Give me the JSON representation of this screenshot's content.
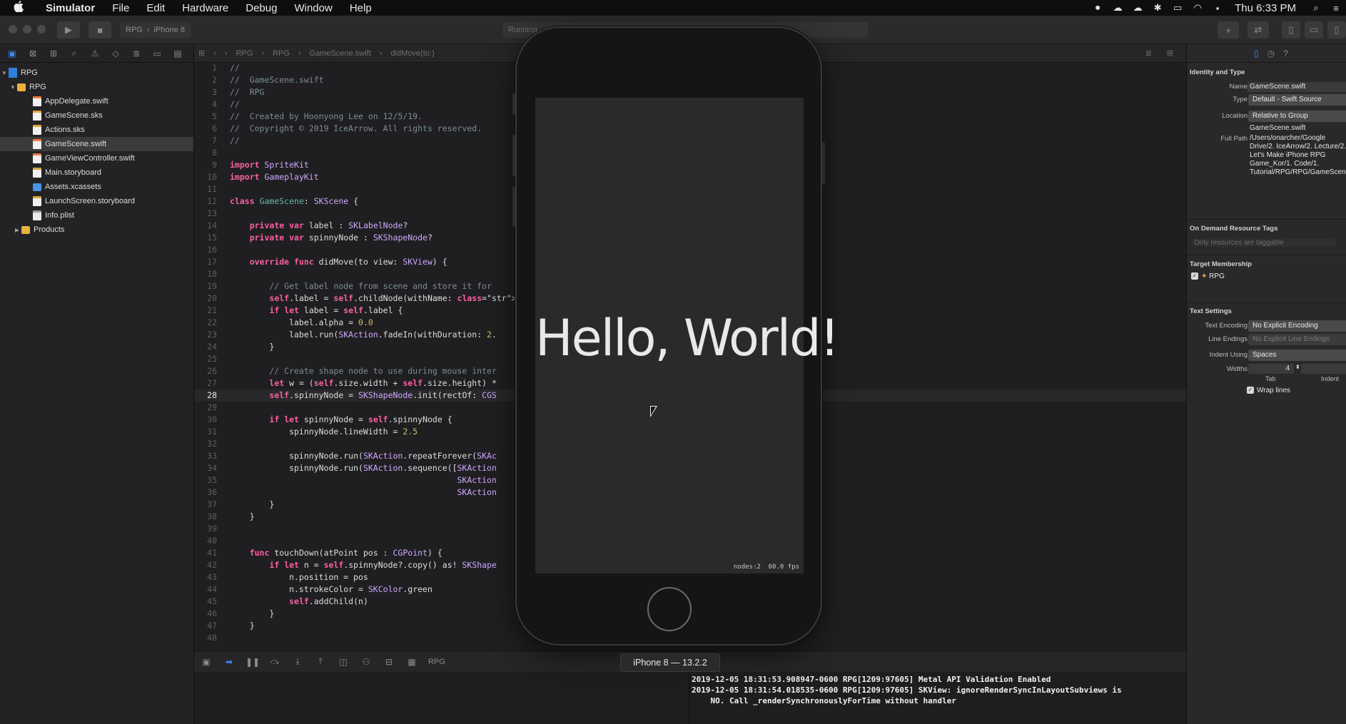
{
  "menubar": {
    "apple": "",
    "app_name": "Simulator",
    "items": [
      "File",
      "Edit",
      "Hardware",
      "Debug",
      "Window",
      "Help"
    ],
    "clock": "Thu 6:33 PM"
  },
  "toolbar": {
    "scheme": "RPG",
    "device": "iPhone 8",
    "activity": "Running"
  },
  "navigator": {
    "project": "RPG",
    "group": "RPG",
    "files": [
      {
        "name": "AppDelegate.swift",
        "kind": "swift"
      },
      {
        "name": "GameScene.sks",
        "kind": "sks"
      },
      {
        "name": "Actions.sks",
        "kind": "sks"
      },
      {
        "name": "GameScene.swift",
        "kind": "swift"
      },
      {
        "name": "GameViewController.swift",
        "kind": "swift"
      },
      {
        "name": "Main.storyboard",
        "kind": "sb"
      },
      {
        "name": "Assets.xcassets",
        "kind": "assets"
      },
      {
        "name": "LaunchScreen.storyboard",
        "kind": "sb"
      },
      {
        "name": "Info.plist",
        "kind": "plist"
      }
    ],
    "products": "Products",
    "selected": "GameScene.swift"
  },
  "jumpbar": {
    "crumbs": [
      "RPG",
      "RPG",
      "GameScene.swift",
      "didMove(to:)"
    ]
  },
  "editor": {
    "current_line": 28,
    "lines": [
      "//",
      "//  GameScene.swift",
      "//  RPG",
      "//",
      "//  Created by Hoonyong Lee on 12/5/19.",
      "//  Copyright © 2019 IceArrow. All rights reserved.",
      "//",
      "",
      "import SpriteKit",
      "import GameplayKit",
      "",
      "class GameScene: SKScene {",
      "",
      "    private var label : SKLabelNode?",
      "    private var spinnyNode : SKShapeNode?",
      "",
      "    override func didMove(to view: SKView) {",
      "",
      "        // Get label node from scene and store it for",
      "        self.label = self.childNode(withName: \"//hello",
      "        if let label = self.label {",
      "            label.alpha = 0.0",
      "            label.run(SKAction.fadeIn(withDuration: 2.",
      "        }",
      "",
      "        // Create shape node to use during mouse inter",
      "        let w = (self.size.width + self.size.height) *",
      "        self.spinnyNode = SKShapeNode.init(rectOf: CGS",
      "",
      "        if let spinnyNode = self.spinnyNode {",
      "            spinnyNode.lineWidth = 2.5",
      "",
      "            spinnyNode.run(SKAction.repeatForever(SKAc",
      "            spinnyNode.run(SKAction.sequence([SKAction",
      "                                              SKAction",
      "                                              SKAction",
      "        }",
      "    }",
      "",
      "",
      "    func touchDown(atPoint pos : CGPoint) {",
      "        if let n = self.spinnyNode?.copy() as! SKShape",
      "            n.position = pos",
      "            n.strokeColor = SKColor.green",
      "            self.addChild(n)",
      "        }",
      "    }",
      ""
    ]
  },
  "debug": {
    "target": "RPG",
    "console_lines": [
      "2019-12-05 18:31:53.908947-0600 RPG[1209:97605] Metal API Validation Enabled",
      "2019-12-05 18:31:54.018535-0600 RPG[1209:97605] SKView: ignoreRenderSyncInLayoutSubviews is",
      "    NO. Call _renderSynchronouslyForTime without handler"
    ]
  },
  "inspector": {
    "identity_title": "Identity and Type",
    "name_label": "Name",
    "name_value": "GameScene.swift",
    "type_label": "Type",
    "type_value": "Default - Swift Source",
    "location_label": "Location",
    "location_value": "Relative to Group",
    "location_file": "GameScene.swift",
    "fullpath_label": "Full Path",
    "fullpath_value": "/Users/onarcher/Google Drive/2. IceArrow/2. Lecture/2. Let's Make iPhone RPG Game_Kor/1. Code/1. Tutorial/RPG/RPG/GameScene.swift",
    "odr_title": "On Demand Resource Tags",
    "odr_placeholder": "Only resources are taggable",
    "target_title": "Target Membership",
    "target_name": "RPG",
    "text_title": "Text Settings",
    "encoding_label": "Text Encoding",
    "encoding_value": "No Explicit Encoding",
    "line_endings_label": "Line Endings",
    "line_endings_value": "No Explicit Line Endings",
    "indent_label": "Indent Using",
    "indent_value": "Spaces",
    "widths_label": "Widths",
    "tab_width": "4",
    "tab_label": "Tab",
    "indent_col_label": "Indent",
    "wrap_label": "Wrap lines"
  },
  "simulator": {
    "hello_text": "Hello, World!",
    "fps_text": "nodes:2  60.0 fps",
    "device_label": "iPhone 8 — 13.2.2"
  }
}
